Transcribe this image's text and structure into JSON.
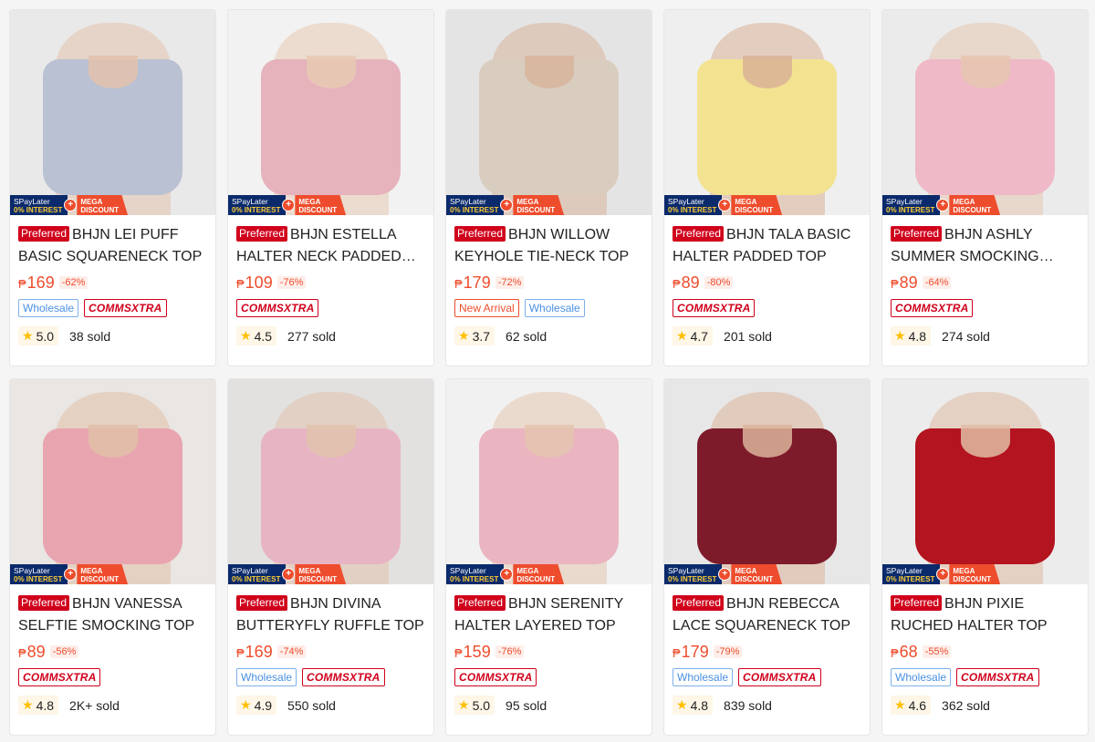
{
  "badges": {
    "spay_line1": "SPayLater",
    "spay_line2": "0% INTEREST",
    "plus": "+",
    "mega_line1": "MEGA",
    "mega_line2": "DISCOUNT",
    "preferred": "Preferred",
    "currency": "₱",
    "star": "★",
    "tag_wholesale": "Wholesale",
    "tag_new_arrival": "New Arrival",
    "tag_comms": "COMMSXTRA"
  },
  "products": [
    {
      "title": "BHJN LEI PUFF BASIC SQUARENECK TOP",
      "price": "169",
      "discount": "-62%",
      "tags": [
        "wholesale",
        "comms"
      ],
      "rating": "5.0",
      "sold": "38 sold",
      "bg": "#e9e9e9",
      "color": "#b9c1d3",
      "skin": "#e3c2ad"
    },
    {
      "title": "BHJN ESTELLA HALTER NECK PADDED TOP",
      "price": "109",
      "discount": "-76%",
      "tags": [
        "comms"
      ],
      "rating": "4.5",
      "sold": "277 sold",
      "bg": "#f2f2f2",
      "color": "#e6b3bd",
      "skin": "#e8c9b3"
    },
    {
      "title": "BHJN WILLOW KEYHOLE TIE-NECK TOP",
      "price": "179",
      "discount": "-72%",
      "tags": [
        "new",
        "wholesale"
      ],
      "rating": "3.7",
      "sold": "62 sold",
      "bg": "#e4e4e4",
      "color": "#d9cdbf",
      "skin": "#d8b49c"
    },
    {
      "title": "BHJN TALA BASIC HALTER PADDED TOP",
      "price": "89",
      "discount": "-80%",
      "tags": [
        "comms"
      ],
      "rating": "4.7",
      "sold": "201 sold",
      "bg": "#efefef",
      "color": "#f3e391",
      "skin": "#d9b196"
    },
    {
      "title": "BHJN ASHLY SUMMER SMOCKING TUBE TOP",
      "price": "89",
      "discount": "-64%",
      "tags": [
        "comms"
      ],
      "rating": "4.8",
      "sold": "274 sold",
      "bg": "#ebebeb",
      "color": "#efb9c7",
      "skin": "#e6c6b1"
    },
    {
      "title": "BHJN VANESSA SELFTIE SMOCKING TOP",
      "price": "89",
      "discount": "-56%",
      "tags": [
        "comms"
      ],
      "rating": "4.8",
      "sold": "2K+ sold",
      "bg": "#e9e6e3",
      "color": "#e8a5b0",
      "skin": "#e1bfa8"
    },
    {
      "title": "BHJN DIVINA BUTTERYFLY RUFFLE TOP",
      "price": "169",
      "discount": "-74%",
      "tags": [
        "wholesale",
        "comms"
      ],
      "rating": "4.9",
      "sold": "550 sold",
      "bg": "#e2e1df",
      "color": "#e7b4c4",
      "skin": "#e2c3ad"
    },
    {
      "title": "BHJN SERENITY HALTER LAYERED TOP",
      "price": "159",
      "discount": "-76%",
      "tags": [
        "comms"
      ],
      "rating": "5.0",
      "sold": "95 sold",
      "bg": "#f1f1f1",
      "color": "#eab4c1",
      "skin": "#e4c4ae"
    },
    {
      "title": "BHJN REBECCA LACE SQUARENECK TOP",
      "price": "179",
      "discount": "-79%",
      "tags": [
        "wholesale",
        "comms"
      ],
      "rating": "4.8",
      "sold": "839 sold",
      "bg": "#e7e7e7",
      "color": "#7d1b2b",
      "skin": "#dcb49b"
    },
    {
      "title": "BHJN PIXIE RUCHED HALTER TOP",
      "price": "68",
      "discount": "-55%",
      "tags": [
        "wholesale",
        "comms"
      ],
      "rating": "4.6",
      "sold": "362 sold",
      "bg": "#ececec",
      "color": "#b3141f",
      "skin": "#e0bca4"
    }
  ]
}
